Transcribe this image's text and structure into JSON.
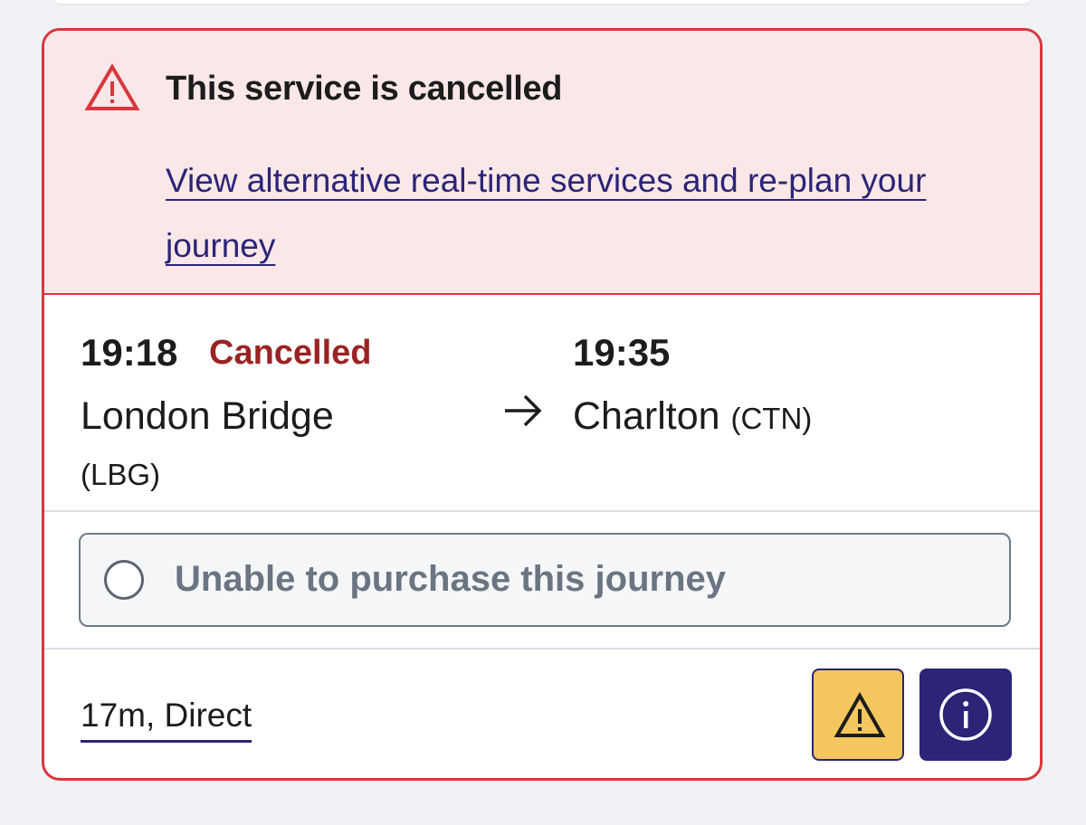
{
  "alert": {
    "title": "This service is cancelled",
    "link": "View alternative real-time services and re-plan your journey",
    "icon": "warning-triangle-icon"
  },
  "journey": {
    "departure": {
      "time": "19:18",
      "status": "Cancelled",
      "station": "London Bridge",
      "code": "(LBG)"
    },
    "arrival": {
      "time": "19:35",
      "station": "Charlton",
      "code": "(CTN)"
    },
    "arrow_icon": "arrow-right-icon"
  },
  "purchase": {
    "label": "Unable to purchase this journey"
  },
  "footer": {
    "duration": "17m, Direct",
    "warning_icon": "warning-icon",
    "info_icon": "info-icon"
  },
  "colors": {
    "alert_red": "#d8373d",
    "alert_bg": "#fae7e8",
    "cancelled_text": "#9b2323",
    "link_purple": "#2b2477",
    "warning_yellow": "#f4c65e",
    "info_navy": "#2b2477"
  }
}
